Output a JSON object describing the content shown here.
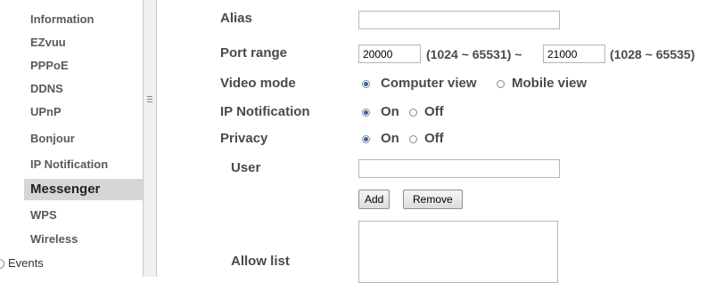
{
  "sidebar": {
    "items": [
      {
        "label": "Information"
      },
      {
        "label": "EZvuu"
      },
      {
        "label": "PPPoE"
      },
      {
        "label": "DDNS"
      },
      {
        "label": "UPnP"
      },
      {
        "label": "Bonjour"
      },
      {
        "label": "IP Notification"
      },
      {
        "label": "Messenger",
        "active": true
      },
      {
        "label": "WPS"
      },
      {
        "label": "Wireless"
      }
    ],
    "events_label": "Events"
  },
  "form": {
    "alias": {
      "label": "Alias",
      "value": ""
    },
    "port_range": {
      "label": "Port range",
      "start_value": "20000",
      "start_hint": "(1024 ~ 65531) ~",
      "end_value": "21000",
      "end_hint": "(1028 ~ 65535)"
    },
    "video_mode": {
      "label": "Video mode",
      "options": [
        "Computer view",
        "Mobile view"
      ],
      "selected": "Computer view"
    },
    "ip_notification": {
      "label": "IP Notification",
      "options": [
        "On",
        "Off"
      ],
      "selected": "On"
    },
    "privacy": {
      "label": "Privacy",
      "options": [
        "On",
        "Off"
      ],
      "selected": "On"
    },
    "user": {
      "label": "User",
      "value": ""
    },
    "buttons": {
      "add": "Add",
      "remove": "Remove"
    },
    "allow_list": {
      "label": "Allow list",
      "items": []
    }
  }
}
